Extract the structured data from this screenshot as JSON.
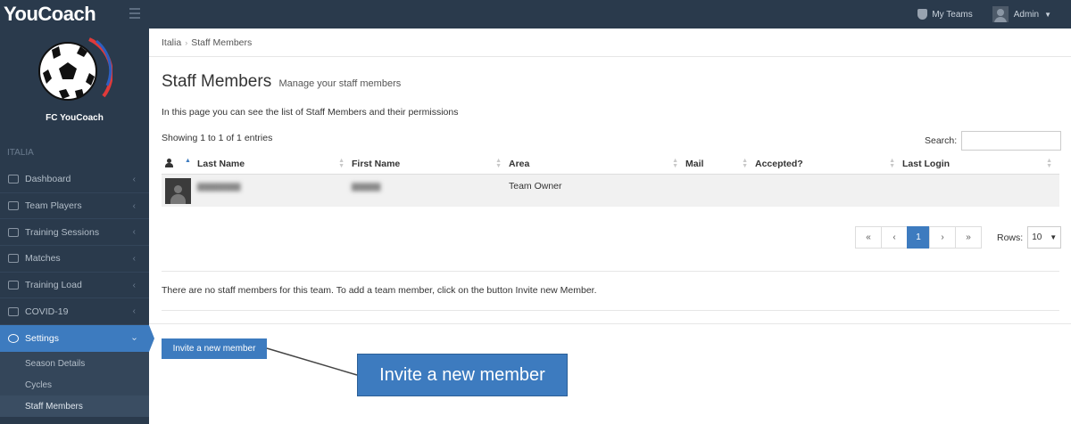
{
  "app": {
    "logo_text": "YouCoach"
  },
  "topbar": {
    "my_teams_label": "My Teams",
    "user_label": "Admin"
  },
  "sidebar": {
    "team_name": "FC YouCoach",
    "section_label": "ITALIA",
    "items": [
      {
        "label": "Dashboard",
        "icon": "bar-chart-icon"
      },
      {
        "label": "Team Players",
        "icon": "players-icon"
      },
      {
        "label": "Training Sessions",
        "icon": "cone-icon"
      },
      {
        "label": "Matches",
        "icon": "match-icon"
      },
      {
        "label": "Training Load",
        "icon": "gauge-icon"
      },
      {
        "label": "COVID-19",
        "icon": "thermometer-icon"
      },
      {
        "label": "Settings",
        "icon": "gear-icon",
        "active": true
      }
    ],
    "sub_items": [
      {
        "label": "Season Details"
      },
      {
        "label": "Cycles"
      },
      {
        "label": "Staff Members",
        "current": true
      }
    ]
  },
  "breadcrumb": {
    "items": [
      "Italia",
      "Staff Members"
    ]
  },
  "main": {
    "title": "Staff Members",
    "subtitle": "Manage your staff members",
    "intro": "In this page you can see the list of Staff Members and their permissions",
    "showing": "Showing 1 to 1 of 1 entries",
    "search_label": "Search:",
    "search_value": ""
  },
  "table": {
    "columns": [
      "Last Name",
      "First Name",
      "Area",
      "Mail",
      "Accepted?",
      "Last Login"
    ],
    "rows": [
      {
        "area": "Team Owner",
        "mail": "",
        "accepted": "",
        "last_login": ""
      }
    ]
  },
  "pagination": {
    "first": "«",
    "prev": "‹",
    "current": "1",
    "next": "›",
    "last": "»",
    "rows_label": "Rows:",
    "rows_value": "10"
  },
  "notice": "There are no staff members for this team. To add a team member, click on the button Invite new Member.",
  "invite_button": "Invite a new member",
  "callout_text": "Invite a new member",
  "colors": {
    "accent": "#3d7bbf",
    "sidebar_bg": "#2a3a4c"
  }
}
